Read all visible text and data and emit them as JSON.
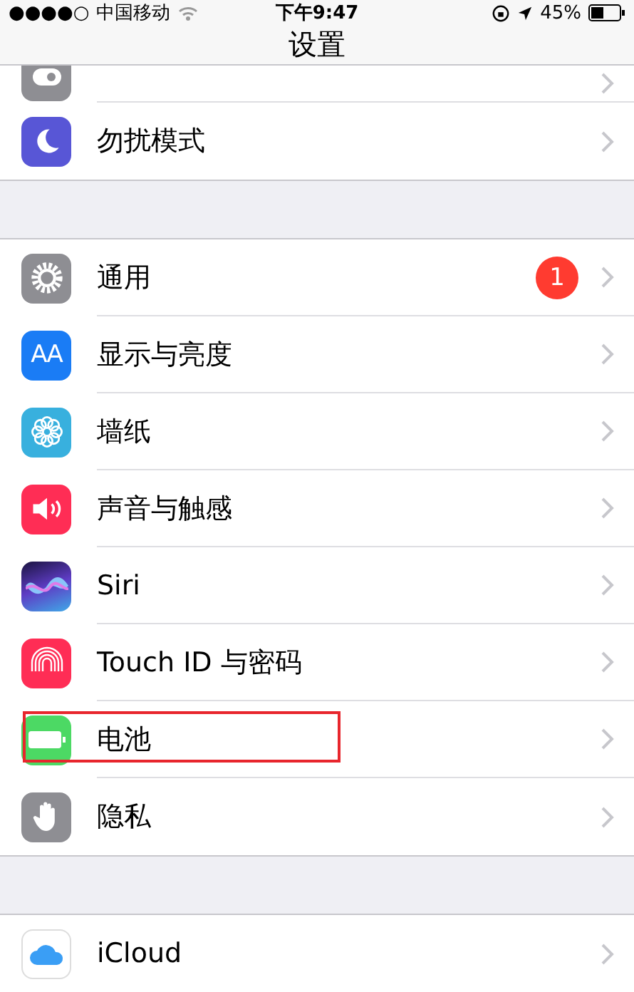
{
  "status_bar": {
    "signal": "●●●●○",
    "carrier": "中国移动",
    "time": "下午9:47",
    "battery": "45%"
  },
  "nav": {
    "title": "设置"
  },
  "groups": [
    {
      "rows": [
        {
          "kind": "control",
          "label": "",
          "highlighted": false
        },
        {
          "kind": "moon",
          "label": "勿扰模式",
          "highlighted": false
        }
      ]
    },
    {
      "rows": [
        {
          "kind": "gear",
          "label": "通用",
          "badge": "1",
          "highlighted": false
        },
        {
          "kind": "display",
          "icon_text": "AA",
          "label": "显示与亮度",
          "highlighted": false
        },
        {
          "kind": "flower",
          "label": "墙纸",
          "highlighted": false
        },
        {
          "kind": "sound",
          "label": "声音与触感",
          "highlighted": false
        },
        {
          "kind": "siri",
          "label": "Siri",
          "highlighted": false
        },
        {
          "kind": "finger",
          "label": "Touch ID 与密码",
          "highlighted": false
        },
        {
          "kind": "battery",
          "label": "电池",
          "highlighted": true
        },
        {
          "kind": "hand",
          "label": "隐私",
          "highlighted": false
        }
      ]
    },
    {
      "rows": [
        {
          "kind": "cloud",
          "label": "iCloud",
          "highlighted": false
        }
      ]
    }
  ]
}
